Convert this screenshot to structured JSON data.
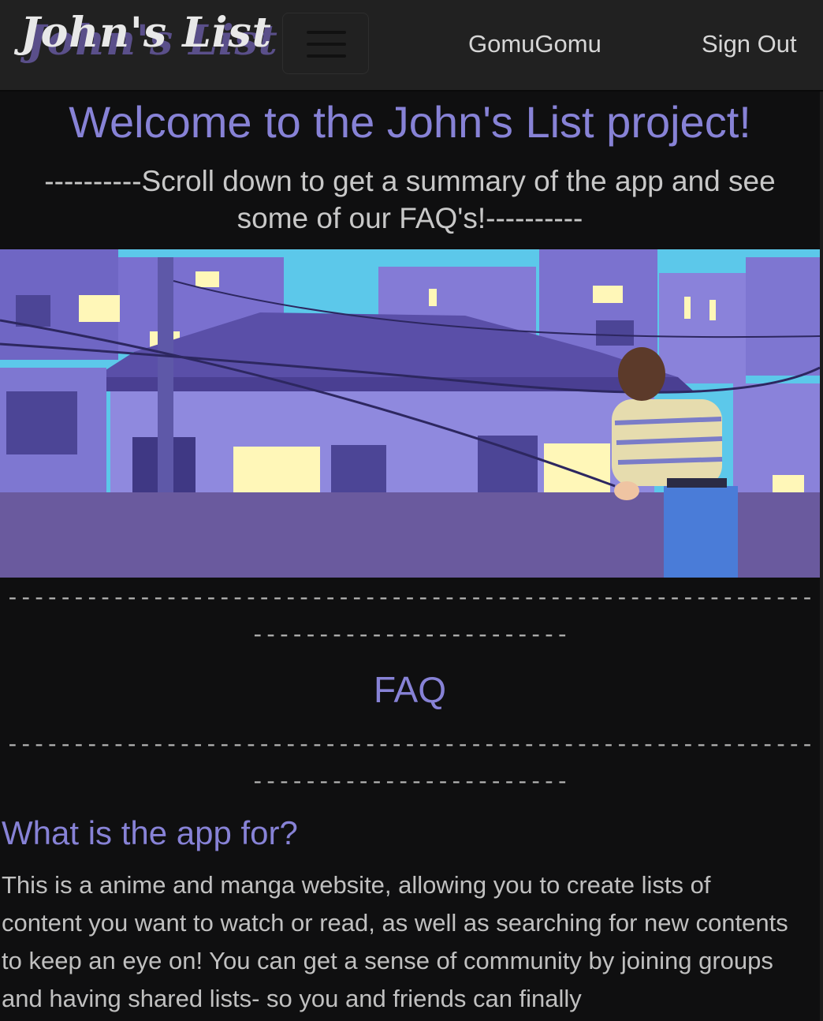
{
  "navbar": {
    "brand": "John's List",
    "toggle_icon": "hamburger-menu-icon",
    "username": "GomuGomu",
    "sign_out": "Sign Out"
  },
  "hero": {
    "title": "Welcome to the John's List project!",
    "subtitle": "----------Scroll down to get a summary of the app and see some of our FAQ's!----------"
  },
  "banner": {
    "colors": {
      "sky": "#5cc8ea",
      "walls": "#7a74d6",
      "roof": "#5a4fa8",
      "window_light": "#fff7b8",
      "ledge": "#6a5a9e"
    }
  },
  "faq": {
    "divider": "-------------------------------------------------------------------------------------",
    "title": "FAQ",
    "questions": [
      {
        "question": "What is the app for?",
        "answer": "This is a anime and manga website, allowing you to create lists of content you want to watch or read, as well as searching for new contents to keep an eye on! You can get a sense of community by joining groups and having shared lists- so you and friends can finally"
      }
    ]
  },
  "theme": {
    "accent": "#8782d6",
    "background": "#0f0f10",
    "navbar_bg": "#212121"
  }
}
